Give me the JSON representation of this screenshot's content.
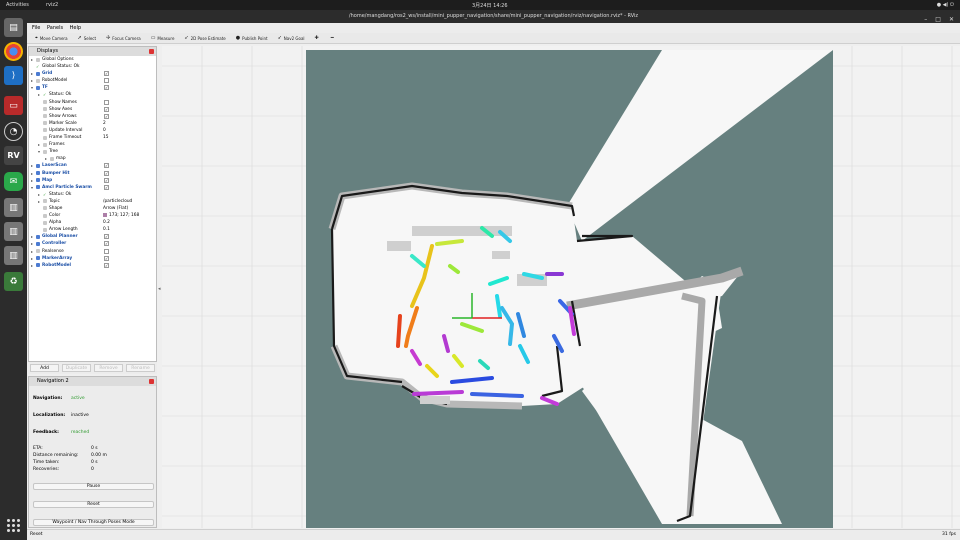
{
  "topbar": {
    "activities": "Activities",
    "app": "rviz2",
    "clock": "3月24日 14:26",
    "system": "●  ◀)  ⏻"
  },
  "window": {
    "title": "/home/mangdang/ros2_ws/install/mini_pupper_navigation/share/mini_pupper_navigation/rviz/navigation.rviz* - RViz"
  },
  "menu": [
    "File",
    "Panels",
    "Help"
  ],
  "toolbar": [
    {
      "icon": "camera-icon",
      "glyph": "⌖",
      "label": "Move Camera"
    },
    {
      "icon": "cursor-icon",
      "glyph": "➚",
      "label": "Select"
    },
    {
      "icon": "focus-icon",
      "glyph": "✢",
      "label": "Focus Camera"
    },
    {
      "icon": "ruler-icon",
      "glyph": "▭",
      "label": "Measure"
    },
    {
      "icon": "pose-estimate-icon",
      "glyph": "➶",
      "label": "2D Pose Estimate"
    },
    {
      "icon": "publish-point-icon",
      "glyph": "●",
      "label": "Publish Point"
    },
    {
      "icon": "nav-goal-icon",
      "glyph": "➶",
      "label": "Nav2 Goal"
    },
    {
      "icon": "add-tool-icon",
      "glyph": "✚",
      "label": ""
    },
    {
      "icon": "remove-tool-icon",
      "glyph": "━",
      "label": ""
    }
  ],
  "displays": {
    "title": "Displays",
    "rows": [
      {
        "indent": 0,
        "arrow": "▸",
        "label": "Global Options",
        "value": "",
        "check": "",
        "bold": false
      },
      {
        "indent": 0,
        "arrow": "",
        "label": "Global Status: Ok",
        "value": "",
        "check": "",
        "bold": false,
        "status": "✓"
      },
      {
        "indent": 0,
        "arrow": "▸",
        "label": "Grid",
        "value": "",
        "check": "✓",
        "bold": true
      },
      {
        "indent": 0,
        "arrow": "▸",
        "label": "RobotModel",
        "value": "",
        "check": " ",
        "bold": false
      },
      {
        "indent": 0,
        "arrow": "▾",
        "label": "TF",
        "value": "",
        "check": "✓",
        "bold": true
      },
      {
        "indent": 1,
        "arrow": "▸",
        "label": "Status: Ok",
        "value": "",
        "check": "",
        "bold": false,
        "status": "✓"
      },
      {
        "indent": 1,
        "arrow": "",
        "label": "Show Names",
        "value": "",
        "check": " ",
        "bold": false
      },
      {
        "indent": 1,
        "arrow": "",
        "label": "Show Axes",
        "value": "",
        "check": "✓",
        "bold": false
      },
      {
        "indent": 1,
        "arrow": "",
        "label": "Show Arrows",
        "value": "",
        "check": "✓",
        "bold": false
      },
      {
        "indent": 1,
        "arrow": "",
        "label": "Marker Scale",
        "value": "2",
        "check": "",
        "bold": false
      },
      {
        "indent": 1,
        "arrow": "",
        "label": "Update Interval",
        "value": "0",
        "check": "",
        "bold": false
      },
      {
        "indent": 1,
        "arrow": "",
        "label": "Frame Timeout",
        "value": "15",
        "check": "",
        "bold": false
      },
      {
        "indent": 1,
        "arrow": "▸",
        "label": "Frames",
        "value": "",
        "check": "",
        "bold": false
      },
      {
        "indent": 1,
        "arrow": "▾",
        "label": "Tree",
        "value": "",
        "check": "",
        "bold": false
      },
      {
        "indent": 2,
        "arrow": "▸",
        "label": "map",
        "value": "",
        "check": "",
        "bold": false
      },
      {
        "indent": 0,
        "arrow": "▸",
        "label": "LaserScan",
        "value": "",
        "check": "✓",
        "bold": true
      },
      {
        "indent": 0,
        "arrow": "▸",
        "label": "Bumper Hit",
        "value": "",
        "check": "✓",
        "bold": true
      },
      {
        "indent": 0,
        "arrow": "▸",
        "label": "Map",
        "value": "",
        "check": "✓",
        "bold": true
      },
      {
        "indent": 0,
        "arrow": "▾",
        "label": "Amcl Particle Swarm",
        "value": "",
        "check": "✓",
        "bold": true
      },
      {
        "indent": 1,
        "arrow": "▸",
        "label": "Status: Ok",
        "value": "",
        "check": "",
        "bold": false,
        "status": "✓"
      },
      {
        "indent": 1,
        "arrow": "▸",
        "label": "Topic",
        "value": "/particlecloud",
        "check": "",
        "bold": false
      },
      {
        "indent": 1,
        "arrow": "",
        "label": "Shape",
        "value": "Arrow (Flat)",
        "check": "",
        "bold": false
      },
      {
        "indent": 1,
        "arrow": "",
        "label": "Color",
        "value": "173; 127; 168",
        "check": "",
        "bold": false,
        "swatch": true
      },
      {
        "indent": 1,
        "arrow": "",
        "label": "Alpha",
        "value": "0.2",
        "check": "",
        "bold": false
      },
      {
        "indent": 1,
        "arrow": "",
        "label": "Arrow Length",
        "value": "0.1",
        "check": "",
        "bold": false
      },
      {
        "indent": 0,
        "arrow": "▸",
        "label": "Global Planner",
        "value": "",
        "check": "✓",
        "bold": true
      },
      {
        "indent": 0,
        "arrow": "▸",
        "label": "Controller",
        "value": "",
        "check": "✓",
        "bold": true
      },
      {
        "indent": 0,
        "arrow": "▸",
        "label": "Realsense",
        "value": "",
        "check": " ",
        "bold": false
      },
      {
        "indent": 0,
        "arrow": "▸",
        "label": "MarkerArray",
        "value": "",
        "check": "✓",
        "bold": true
      },
      {
        "indent": 0,
        "arrow": "▸",
        "label": "RobotModel",
        "value": "",
        "check": "✓",
        "bold": true
      }
    ],
    "buttons": [
      {
        "label": "Add",
        "enabled": true
      },
      {
        "label": "Duplicate",
        "enabled": false
      },
      {
        "label": "Remove",
        "enabled": false
      },
      {
        "label": "Rename",
        "enabled": false
      }
    ]
  },
  "navigation": {
    "title": "Navigation 2",
    "navigation_label": "Navigation:",
    "navigation_value": "active",
    "localization_label": "Localization:",
    "localization_value": "inactive",
    "feedback_label": "Feedback:",
    "feedback_value": "reached",
    "stats": [
      {
        "label": "ETA:",
        "value": "0 s"
      },
      {
        "label": "Distance remaining:",
        "value": "0.00 m"
      },
      {
        "label": "Time taken:",
        "value": "0 s"
      },
      {
        "label": "Recoveries:",
        "value": "0"
      }
    ],
    "pause_label": "Pause",
    "reset_label": "Reset",
    "waypoint_label": "Waypoint / Nav Through Poses Mode"
  },
  "statusbar": {
    "reset_label": "Reset",
    "fps": "31 fps"
  },
  "colors": {
    "map_unknown": "#66807f",
    "map_free": "#f7f7f7",
    "map_wall": "#1a1a1a",
    "costmap_light": "#c9c9c9",
    "costmap_mid": "#9a9a9a"
  }
}
